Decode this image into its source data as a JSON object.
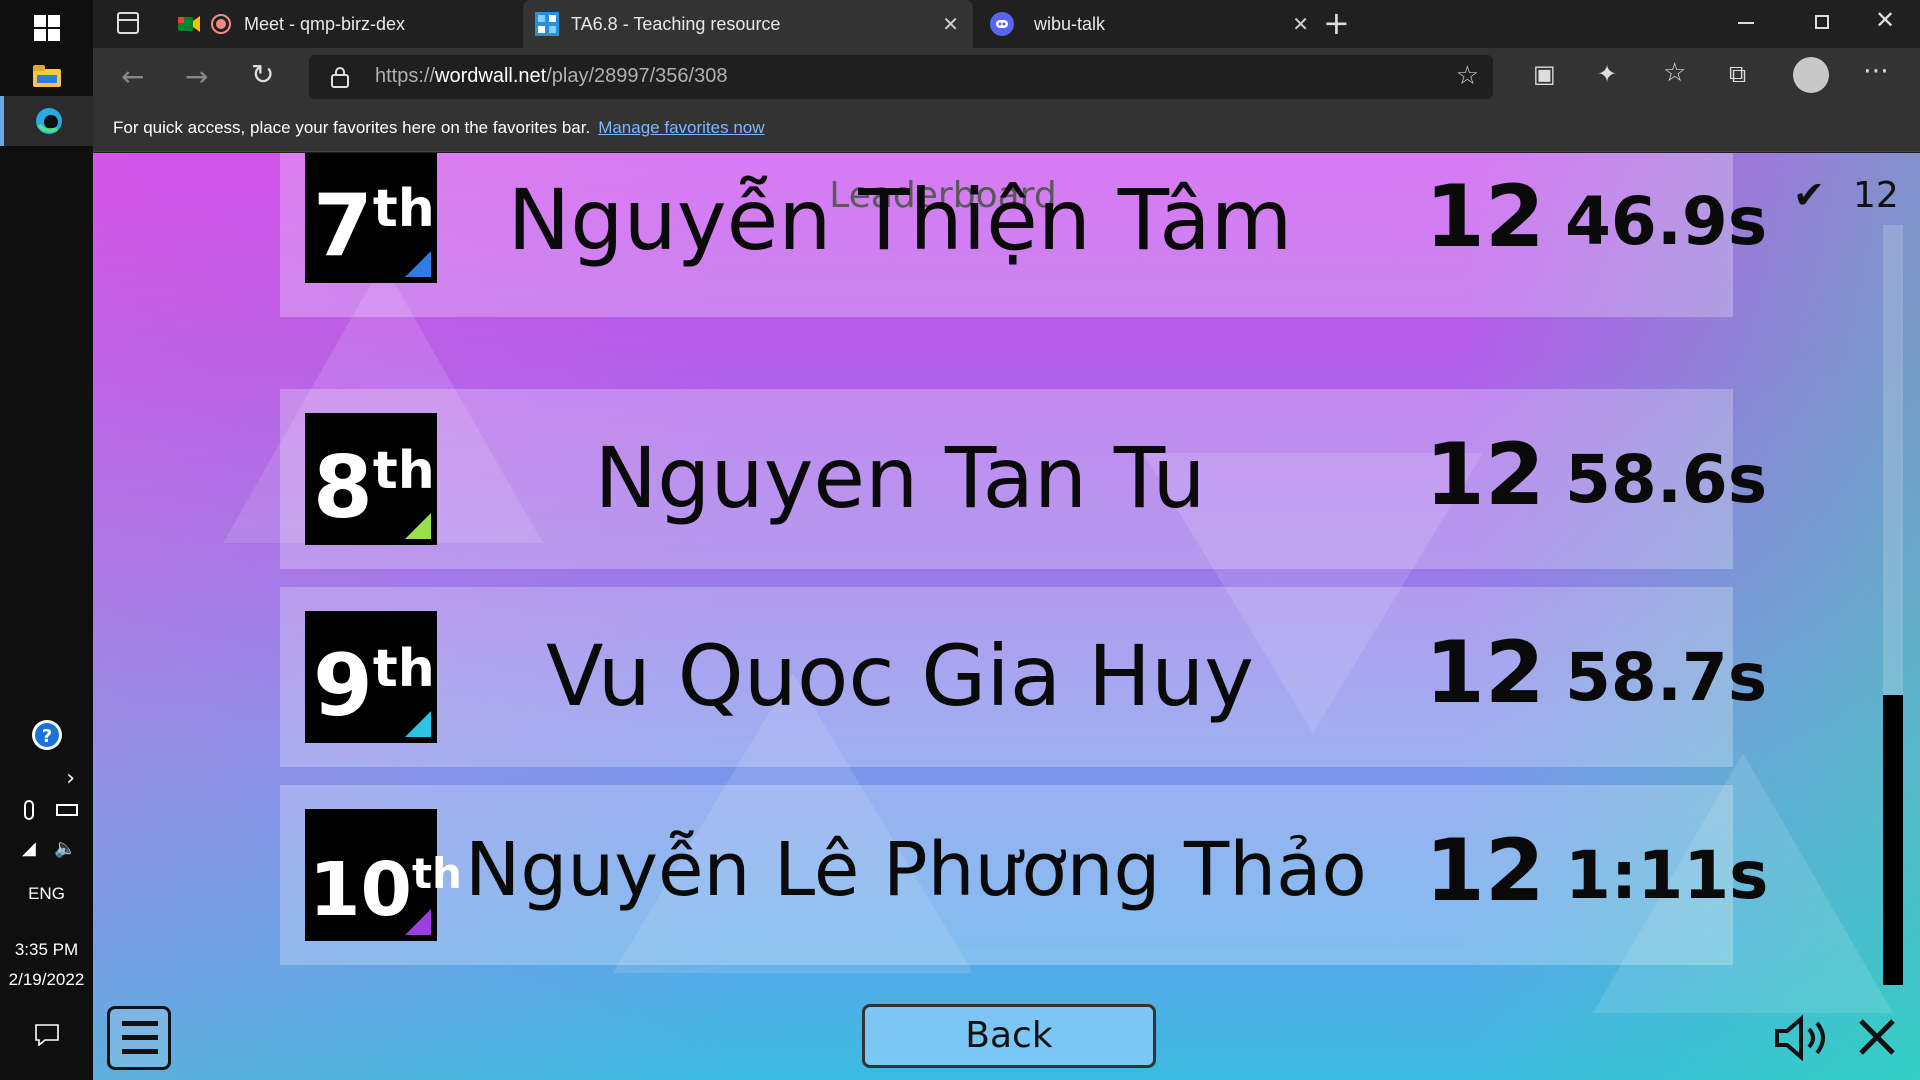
{
  "taskbar": {
    "language": "ENG",
    "time": "3:35 PM",
    "date": "2/19/2022"
  },
  "browser": {
    "tabs": [
      {
        "label": "Meet - qmp-birz-dex"
      },
      {
        "label": "TA6.8 - Teaching resource"
      },
      {
        "label": "wibu-talk"
      }
    ],
    "url_prefix": "https://",
    "url_host": "wordwall.net",
    "url_path": "/play/28997/356/308",
    "favorites_text": "For quick access, place your favorites here on the favorites bar.",
    "favorites_link": "Manage favorites now"
  },
  "game": {
    "title": "Leaderboard",
    "correct_count": "12",
    "back_label": "Back",
    "colors": {
      "corner_7": "#2f7de0",
      "corner_8": "#9be04a",
      "corner_9": "#2cc4e0",
      "corner_10": "#9b3fe0"
    },
    "rows": [
      {
        "rank": "7",
        "suffix": "th",
        "name": "Nguyễn Thiện Tâm",
        "score": "12",
        "time": "46.9s"
      },
      {
        "rank": "8",
        "suffix": "th",
        "name": "Nguyen Tan Tu",
        "score": "12",
        "time": "58.6s"
      },
      {
        "rank": "9",
        "suffix": "th",
        "name": "Vu Quoc Gia Huy",
        "score": "12",
        "time": "58.7s"
      },
      {
        "rank": "10",
        "suffix": "th",
        "name": "Nguyễn Lê Phương Thảo",
        "score": "12",
        "time": "1:11s"
      }
    ]
  }
}
